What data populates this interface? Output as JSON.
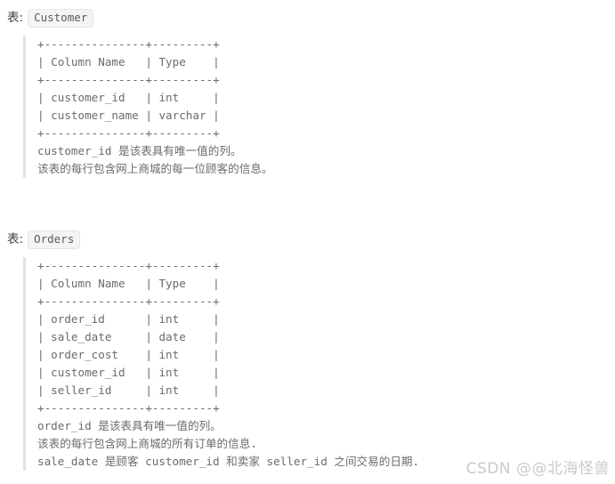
{
  "page": {
    "background_color": "#ffffff",
    "text_color": "#6b6b6b",
    "chip_background": "#f4f4f4",
    "quote_bar_color": "#e2e2e2",
    "watermark_color": "#c9c9c9"
  },
  "sections": [
    {
      "heading_label": "表:",
      "table_name": "Customer",
      "schema_block": "+---------------+---------+\n| Column Name   | Type    |\n+---------------+---------+\n| customer_id   | int     |\n| customer_name | varchar |\n+---------------+---------+",
      "columns": [
        {
          "name": "Column Name",
          "type": "Type"
        },
        {
          "name": "customer_id",
          "type": "int"
        },
        {
          "name": "customer_name",
          "type": "varchar"
        }
      ],
      "descriptions": [
        "customer_id 是该表具有唯一值的列。",
        "该表的每行包含网上商城的每一位顾客的信息。"
      ]
    },
    {
      "heading_label": "表:",
      "table_name": "Orders",
      "schema_block": "+---------------+---------+\n| Column Name   | Type    |\n+---------------+---------+\n| order_id      | int     |\n| sale_date     | date    |\n| order_cost    | int     |\n| customer_id   | int     |\n| seller_id     | int     |\n+---------------+---------+",
      "columns": [
        {
          "name": "Column Name",
          "type": "Type"
        },
        {
          "name": "order_id",
          "type": "int"
        },
        {
          "name": "sale_date",
          "type": "date"
        },
        {
          "name": "order_cost",
          "type": "int"
        },
        {
          "name": "customer_id",
          "type": "int"
        },
        {
          "name": "seller_id",
          "type": "int"
        }
      ],
      "descriptions": [
        "order_id 是该表具有唯一值的列。",
        "该表的每行包含网上商城的所有订单的信息.",
        "sale_date 是顾客 customer_id 和卖家 seller_id 之间交易的日期."
      ]
    }
  ],
  "watermark": {
    "text": "CSDN @@北海怪兽"
  }
}
